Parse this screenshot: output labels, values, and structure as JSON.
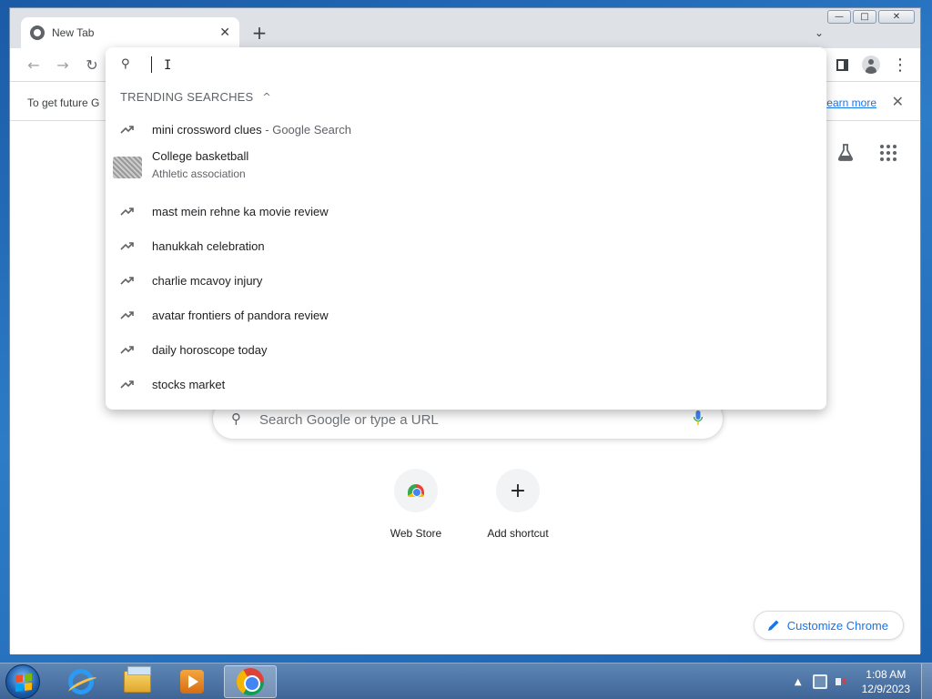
{
  "window": {
    "controls": {
      "minimize": "—",
      "maximize": "□",
      "close": "✕"
    }
  },
  "tabs": [
    {
      "title": "New Tab",
      "close": "✕"
    }
  ],
  "tabstrip": {
    "new_tab": "+",
    "tab_search": "⌄"
  },
  "toolbar": {
    "back": "←",
    "forward": "→",
    "reload": "↻",
    "menu": "⋮"
  },
  "infobar": {
    "message": "To get future G",
    "link": "earn more",
    "close": "✕"
  },
  "omnibox": {
    "search_icon": "⚲",
    "input_value": "",
    "cursor": "I",
    "trending_header": "TRENDING SEARCHES",
    "collapse_chevron": "^",
    "suggestions": [
      {
        "type": "trending",
        "text": "mini crossword clues",
        "suffix": " - Google Search"
      },
      {
        "type": "entity",
        "text": "College basketball",
        "subtitle": "Athletic association"
      },
      {
        "type": "trending",
        "text": "mast mein rehne ka movie review"
      },
      {
        "type": "trending",
        "text": "hanukkah celebration"
      },
      {
        "type": "trending",
        "text": "charlie mcavoy injury"
      },
      {
        "type": "trending",
        "text": "avatar frontiers of pandora review"
      },
      {
        "type": "trending",
        "text": "daily horoscope today"
      },
      {
        "type": "trending",
        "text": "stocks market"
      }
    ]
  },
  "ntp": {
    "search_placeholder": "Search Google or type a URL",
    "search_icon": "⚲",
    "shortcuts": [
      {
        "label": "Web Store",
        "icon": "web-store-icon"
      },
      {
        "label": "Add shortcut",
        "icon": "plus-icon",
        "glyph": "+"
      }
    ],
    "customize_label": "Customize Chrome"
  },
  "taskbar": {
    "apps": [
      "internet-explorer",
      "windows-explorer",
      "media-player",
      "google-chrome"
    ],
    "tray_up": "▲",
    "time": "1:08 AM",
    "date": "12/9/2023"
  },
  "colors": {
    "accent": "#1a73e8",
    "text": "#202124",
    "muted": "#5f6368"
  }
}
